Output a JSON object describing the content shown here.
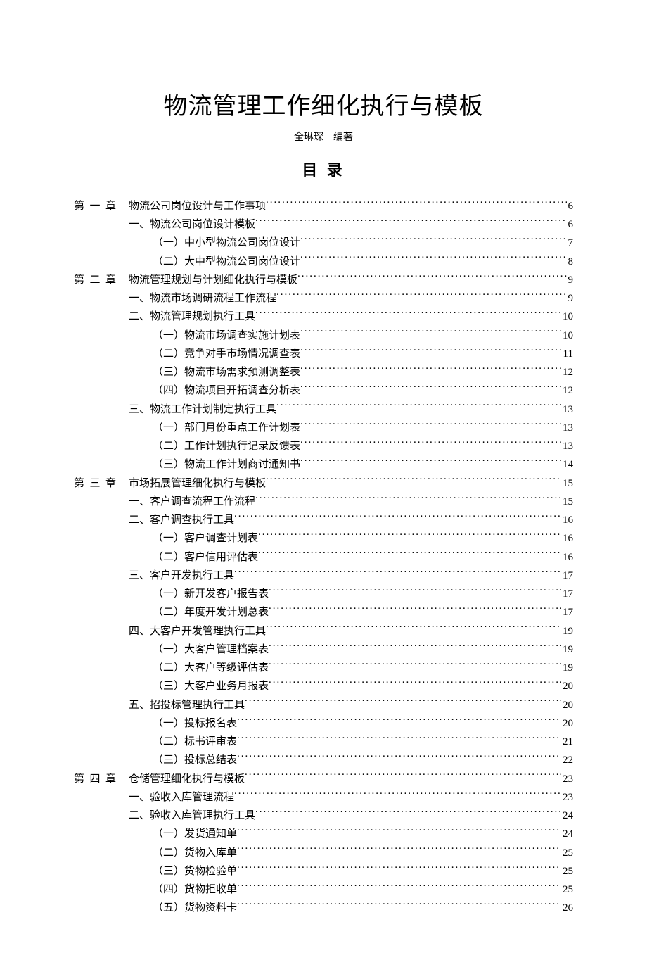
{
  "title": "物流管理工作细化执行与模板",
  "author": "全琳琛　编著",
  "toc_heading": "目 录",
  "toc": [
    {
      "level": 0,
      "chapter": "第一章",
      "text": "物流公司岗位设计与工作事项",
      "page": "6"
    },
    {
      "level": 1,
      "chapter": "",
      "text": "一、物流公司岗位设计模板",
      "page": "6"
    },
    {
      "level": 2,
      "chapter": "",
      "text": "（一）中小型物流公司岗位设计",
      "page": "7"
    },
    {
      "level": 2,
      "chapter": "",
      "text": "（二）大中型物流公司岗位设计",
      "page": "8"
    },
    {
      "level": 0,
      "chapter": "第二章",
      "text": "物流管理规划与计划细化执行与模板",
      "page": "9"
    },
    {
      "level": 1,
      "chapter": "",
      "text": "一、物流市场调研流程工作流程",
      "page": "9"
    },
    {
      "level": 1,
      "chapter": "",
      "text": "二、物流管理规划执行工具",
      "page": "10"
    },
    {
      "level": 2,
      "chapter": "",
      "text": "（一）物流市场调查实施计划表",
      "page": "10"
    },
    {
      "level": 2,
      "chapter": "",
      "text": "（二）竞争对手市场情况调查表",
      "page": "11"
    },
    {
      "level": 2,
      "chapter": "",
      "text": "（三）物流市场需求预测调整表",
      "page": "12"
    },
    {
      "level": 2,
      "chapter": "",
      "text": "（四）物流项目开拓调查分析表",
      "page": "12"
    },
    {
      "level": 1,
      "chapter": "",
      "text": "三、物流工作计划制定执行工具",
      "page": "13"
    },
    {
      "level": 2,
      "chapter": "",
      "text": "（一）部门月份重点工作计划表",
      "page": "13"
    },
    {
      "level": 2,
      "chapter": "",
      "text": "（二）工作计划执行记录反馈表",
      "page": "13"
    },
    {
      "level": 2,
      "chapter": "",
      "text": "（三）物流工作计划商讨通知书",
      "page": "14"
    },
    {
      "level": 0,
      "chapter": "第三章",
      "text": "市场拓展管理细化执行与模板",
      "page": "15"
    },
    {
      "level": 1,
      "chapter": "",
      "text": "一、客户调查流程工作流程",
      "page": "15"
    },
    {
      "level": 1,
      "chapter": "",
      "text": "二、客户调查执行工具",
      "page": "16"
    },
    {
      "level": 2,
      "chapter": "",
      "text": "（一）客户调查计划表",
      "page": "16"
    },
    {
      "level": 2,
      "chapter": "",
      "text": "（二）客户信用评估表",
      "page": "16"
    },
    {
      "level": 1,
      "chapter": "",
      "text": "三、客户开发执行工具",
      "page": "17"
    },
    {
      "level": 2,
      "chapter": "",
      "text": "（一）新开发客户报告表",
      "page": "17"
    },
    {
      "level": 2,
      "chapter": "",
      "text": "（二）年度开发计划总表",
      "page": "17"
    },
    {
      "level": 1,
      "chapter": "",
      "text": "四、大客户开发管理执行工具",
      "page": "19"
    },
    {
      "level": 2,
      "chapter": "",
      "text": "（一）大客户管理档案表",
      "page": "19"
    },
    {
      "level": 2,
      "chapter": "",
      "text": "（二）大客户等级评估表",
      "page": "19"
    },
    {
      "level": 2,
      "chapter": "",
      "text": "（三）大客户业务月报表",
      "page": "20"
    },
    {
      "level": 1,
      "chapter": "",
      "text": "五、招投标管理执行工具",
      "page": "20"
    },
    {
      "level": 2,
      "chapter": "",
      "text": "（一）投标报名表",
      "page": "20"
    },
    {
      "level": 2,
      "chapter": "",
      "text": "（二）标书评审表",
      "page": "21"
    },
    {
      "level": 2,
      "chapter": "",
      "text": "（三）投标总结表",
      "page": "22"
    },
    {
      "level": 0,
      "chapter": "第四章",
      "text": "仓储管理细化执行与模板",
      "page": "23"
    },
    {
      "level": 1,
      "chapter": "",
      "text": "一、验收入库管理流程",
      "page": "23"
    },
    {
      "level": 1,
      "chapter": "",
      "text": "二、验收入库管理执行工具",
      "page": "24"
    },
    {
      "level": 2,
      "chapter": "",
      "text": "（一）发货通知单",
      "page": "24"
    },
    {
      "level": 2,
      "chapter": "",
      "text": "（二）货物入库单",
      "page": "25"
    },
    {
      "level": 2,
      "chapter": "",
      "text": "（三）货物检验单",
      "page": "25"
    },
    {
      "level": 2,
      "chapter": "",
      "text": "（四）货物拒收单",
      "page": "25"
    },
    {
      "level": 2,
      "chapter": "",
      "text": "（五）货物资料卡",
      "page": "26"
    }
  ]
}
